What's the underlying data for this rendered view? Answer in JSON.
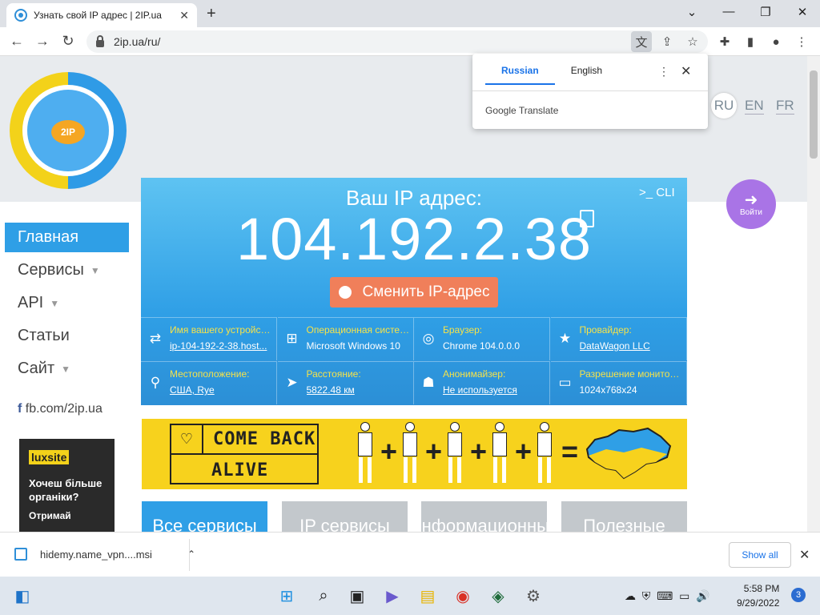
{
  "browser": {
    "tab_title": "Узнать свой IP адрес | 2IP.ua",
    "url": "2ip.ua/ru/"
  },
  "translate_popup": {
    "tabs": [
      "Russian",
      "English"
    ],
    "active_tab": "Russian",
    "provider": "Google Translate"
  },
  "header": {
    "logo_text": "2IP",
    "languages": [
      "RU",
      "EN",
      "FR"
    ],
    "active_language": "RU",
    "login_label": "Войти"
  },
  "sidebar": {
    "items": [
      {
        "label": "Главная",
        "active": true,
        "has_dropdown": false
      },
      {
        "label": "Сервисы",
        "active": false,
        "has_dropdown": true
      },
      {
        "label": "API",
        "active": false,
        "has_dropdown": true
      },
      {
        "label": "Статьи",
        "active": false,
        "has_dropdown": false
      },
      {
        "label": "Сайт",
        "active": false,
        "has_dropdown": true
      }
    ],
    "facebook": "fb.com/2ip.ua",
    "ad": {
      "brand": "luxsite",
      "line1": "Хочеш більше органіки?",
      "line2": "Отримай"
    }
  },
  "hero": {
    "label": "Ваш IP адрес:",
    "ip": "104.192.2.38",
    "cli_label": ">_ CLI",
    "change_button": "Сменить IP-адрес",
    "info": [
      {
        "title": "Имя вашего устройства:",
        "value": "ip-104-192-2-38.host...",
        "link": true,
        "icon": "swap-icon"
      },
      {
        "title": "Операционная система:",
        "value": "Microsoft Windows 10",
        "link": false,
        "icon": "windows-icon"
      },
      {
        "title": "Браузер:",
        "value": "Chrome 104.0.0.0",
        "link": false,
        "icon": "chrome-icon"
      },
      {
        "title": "Провайдер:",
        "value": "DataWagon LLC",
        "link": true,
        "icon": "star-icon"
      },
      {
        "title": "Местоположение:",
        "value": "США, Rye",
        "link": true,
        "icon": "location-pin-icon"
      },
      {
        "title": "Расстояние:",
        "value": "5822.48 км",
        "link": true,
        "icon": "navigation-arrow-icon"
      },
      {
        "title": "Анонимайзер:",
        "value": "Не используется",
        "link": true,
        "icon": "anonymizer-icon"
      },
      {
        "title": "Разрешение монитора:",
        "value": "1024x768x24",
        "link": false,
        "icon": "monitor-icon"
      }
    ]
  },
  "banner": {
    "line1": "COME BACK",
    "line2": "ALIVE",
    "colors": {
      "yellow": "#f7d21d",
      "blue": "#2f9fe6"
    }
  },
  "tiles": [
    {
      "label": "Все сервисы",
      "color": "#2f9fe6"
    },
    {
      "label": "IP сервисы",
      "color": "#c3c8cc"
    },
    {
      "label": "Информационные",
      "color": "#c3c8cc"
    },
    {
      "label": "Полезные",
      "color": "#c3c8cc"
    }
  ],
  "download_bar": {
    "filename": "hidemy.name_vpn....msi",
    "show_all": "Show all"
  },
  "taskbar": {
    "time": "5:58 PM",
    "date": "9/29/2022",
    "notification_count": "3"
  }
}
